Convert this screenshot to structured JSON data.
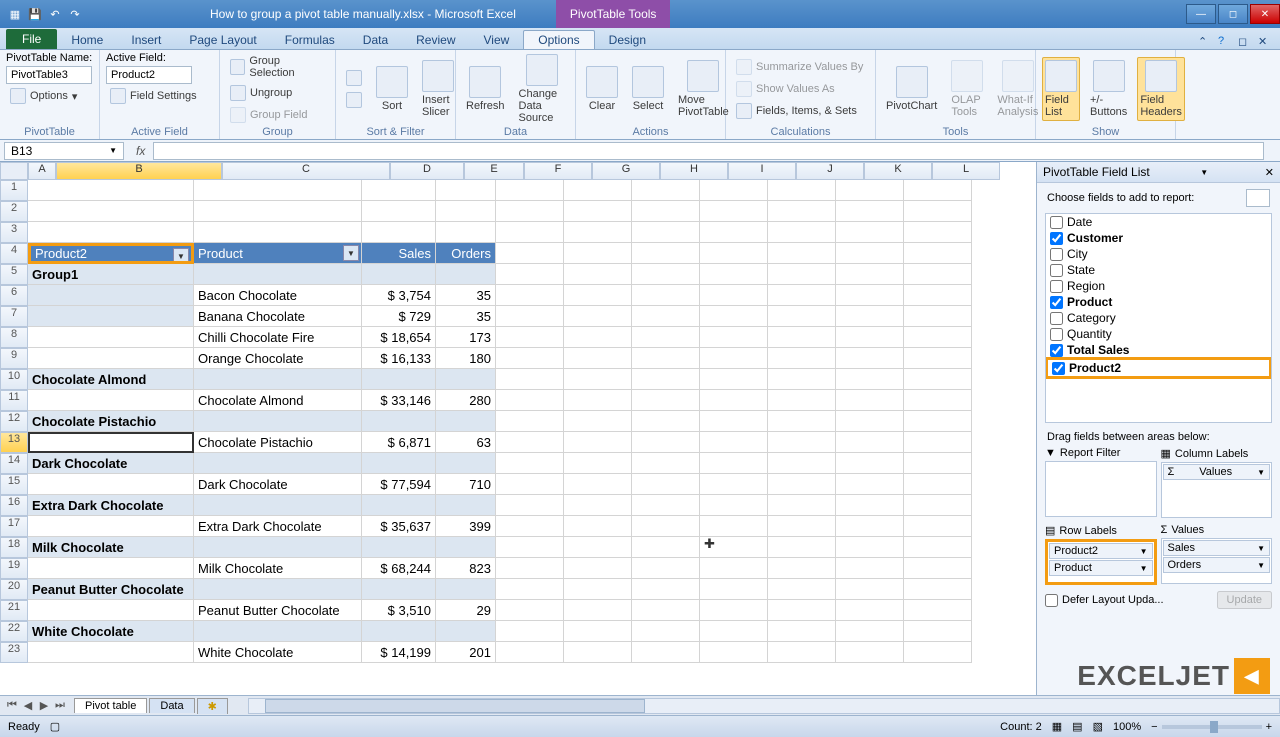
{
  "title": "How to group a pivot table manually.xlsx - Microsoft Excel",
  "pivot_tools_label": "PivotTable Tools",
  "tabs": {
    "file": "File",
    "home": "Home",
    "insert": "Insert",
    "page_layout": "Page Layout",
    "formulas": "Formulas",
    "data": "Data",
    "review": "Review",
    "view": "View",
    "options": "Options",
    "design": "Design"
  },
  "ribbon": {
    "pivottable": {
      "name_label": "PivotTable Name:",
      "name_value": "PivotTable3",
      "options": "Options",
      "group": "PivotTable"
    },
    "active_field": {
      "label": "Active Field:",
      "value": "Product2",
      "settings": "Field Settings",
      "group": "Active Field"
    },
    "group": {
      "sel": "Group Selection",
      "ungroup": "Ungroup",
      "field": "Group Field",
      "group": "Group"
    },
    "sort": {
      "sort": "Sort",
      "group": "Sort & Filter"
    },
    "slicer": {
      "label": "Insert Slicer",
      "group": "Sort & Filter"
    },
    "data": {
      "refresh": "Refresh",
      "change": "Change Data Source",
      "group": "Data"
    },
    "actions": {
      "clear": "Clear",
      "select": "Select",
      "move": "Move PivotTable",
      "group": "Actions"
    },
    "calc": {
      "summarize": "Summarize Values By",
      "show_as": "Show Values As",
      "fields": "Fields, Items, & Sets",
      "group": "Calculations"
    },
    "tools": {
      "chart": "PivotChart",
      "olap": "OLAP Tools",
      "whatif": "What-If Analysis",
      "group": "Tools"
    },
    "show": {
      "fieldlist": "Field List",
      "buttons": "+/- Buttons",
      "headers": "Field Headers",
      "group": "Show"
    }
  },
  "namebox": "B13",
  "columns": [
    "A",
    "B",
    "C",
    "D",
    "E",
    "F",
    "G",
    "H",
    "I",
    "J",
    "K",
    "L"
  ],
  "col_widths": {
    "A": 28,
    "B": 166,
    "C": 168,
    "D": 74,
    "E": 60,
    "rest": 68
  },
  "pivot_headers": {
    "p2": "Product2",
    "product": "Product",
    "sales": "Sales",
    "orders": "Orders"
  },
  "rows": [
    {
      "r": 1
    },
    {
      "r": 2
    },
    {
      "r": 3
    },
    {
      "r": 4,
      "type": "hdr"
    },
    {
      "r": 5,
      "b": "Group1",
      "type": "group"
    },
    {
      "r": 6,
      "c": "Bacon Chocolate",
      "d": "$    3,754",
      "e": "35",
      "type": "sub"
    },
    {
      "r": 7,
      "c": "Banana Chocolate",
      "d": "$       729",
      "e": "35",
      "type": "sub"
    },
    {
      "r": 8,
      "c": "Chilli Chocolate Fire",
      "d": "$  18,654",
      "e": "173"
    },
    {
      "r": 9,
      "c": "Orange Chocolate",
      "d": "$  16,133",
      "e": "180"
    },
    {
      "r": 10,
      "b": "Chocolate Almond",
      "type": "group"
    },
    {
      "r": 11,
      "c": "Chocolate Almond",
      "d": "$  33,146",
      "e": "280"
    },
    {
      "r": 12,
      "b": "Chocolate Pistachio",
      "type": "group"
    },
    {
      "r": 13,
      "c": "Chocolate Pistachio",
      "d": "$    6,871",
      "e": "63",
      "sel": true
    },
    {
      "r": 14,
      "b": "Dark Chocolate",
      "type": "group"
    },
    {
      "r": 15,
      "c": "Dark Chocolate",
      "d": "$  77,594",
      "e": "710"
    },
    {
      "r": 16,
      "b": "Extra Dark Chocolate",
      "type": "group"
    },
    {
      "r": 17,
      "c": "Extra Dark Chocolate",
      "d": "$  35,637",
      "e": "399"
    },
    {
      "r": 18,
      "b": "Milk Chocolate",
      "type": "group"
    },
    {
      "r": 19,
      "c": "Milk Chocolate",
      "d": "$  68,244",
      "e": "823"
    },
    {
      "r": 20,
      "b": "Peanut Butter Chocolate",
      "type": "group"
    },
    {
      "r": 21,
      "c": "Peanut Butter Chocolate",
      "d": "$    3,510",
      "e": "29"
    },
    {
      "r": 22,
      "b": "White Chocolate",
      "type": "group"
    },
    {
      "r": 23,
      "c": "White Chocolate",
      "d": "$  14,199",
      "e": "201"
    }
  ],
  "fieldlist": {
    "title": "PivotTable Field List",
    "choose": "Choose fields to add to report:",
    "fields": [
      {
        "name": "Date",
        "checked": false
      },
      {
        "name": "Customer",
        "checked": true
      },
      {
        "name": "City",
        "checked": false
      },
      {
        "name": "State",
        "checked": false
      },
      {
        "name": "Region",
        "checked": false
      },
      {
        "name": "Product",
        "checked": true
      },
      {
        "name": "Category",
        "checked": false
      },
      {
        "name": "Quantity",
        "checked": false
      },
      {
        "name": "Total Sales",
        "checked": true
      },
      {
        "name": "Product2",
        "checked": true,
        "highlight": true
      }
    ],
    "drag": "Drag fields between areas below:",
    "areas": {
      "filter": "Report Filter",
      "columns": "Column Labels",
      "rows": "Row Labels",
      "values": "Values"
    },
    "col_items": [
      "Values"
    ],
    "row_items": [
      "Product2",
      "Product"
    ],
    "val_items": [
      "Sales",
      "Orders"
    ],
    "defer": "Defer Layout Upda...",
    "update": "Update"
  },
  "sheets": {
    "active": "Pivot table",
    "other": "Data"
  },
  "status": {
    "ready": "Ready",
    "count": "Count: 2",
    "zoom": "100%"
  },
  "watermark": "EXCELJET"
}
